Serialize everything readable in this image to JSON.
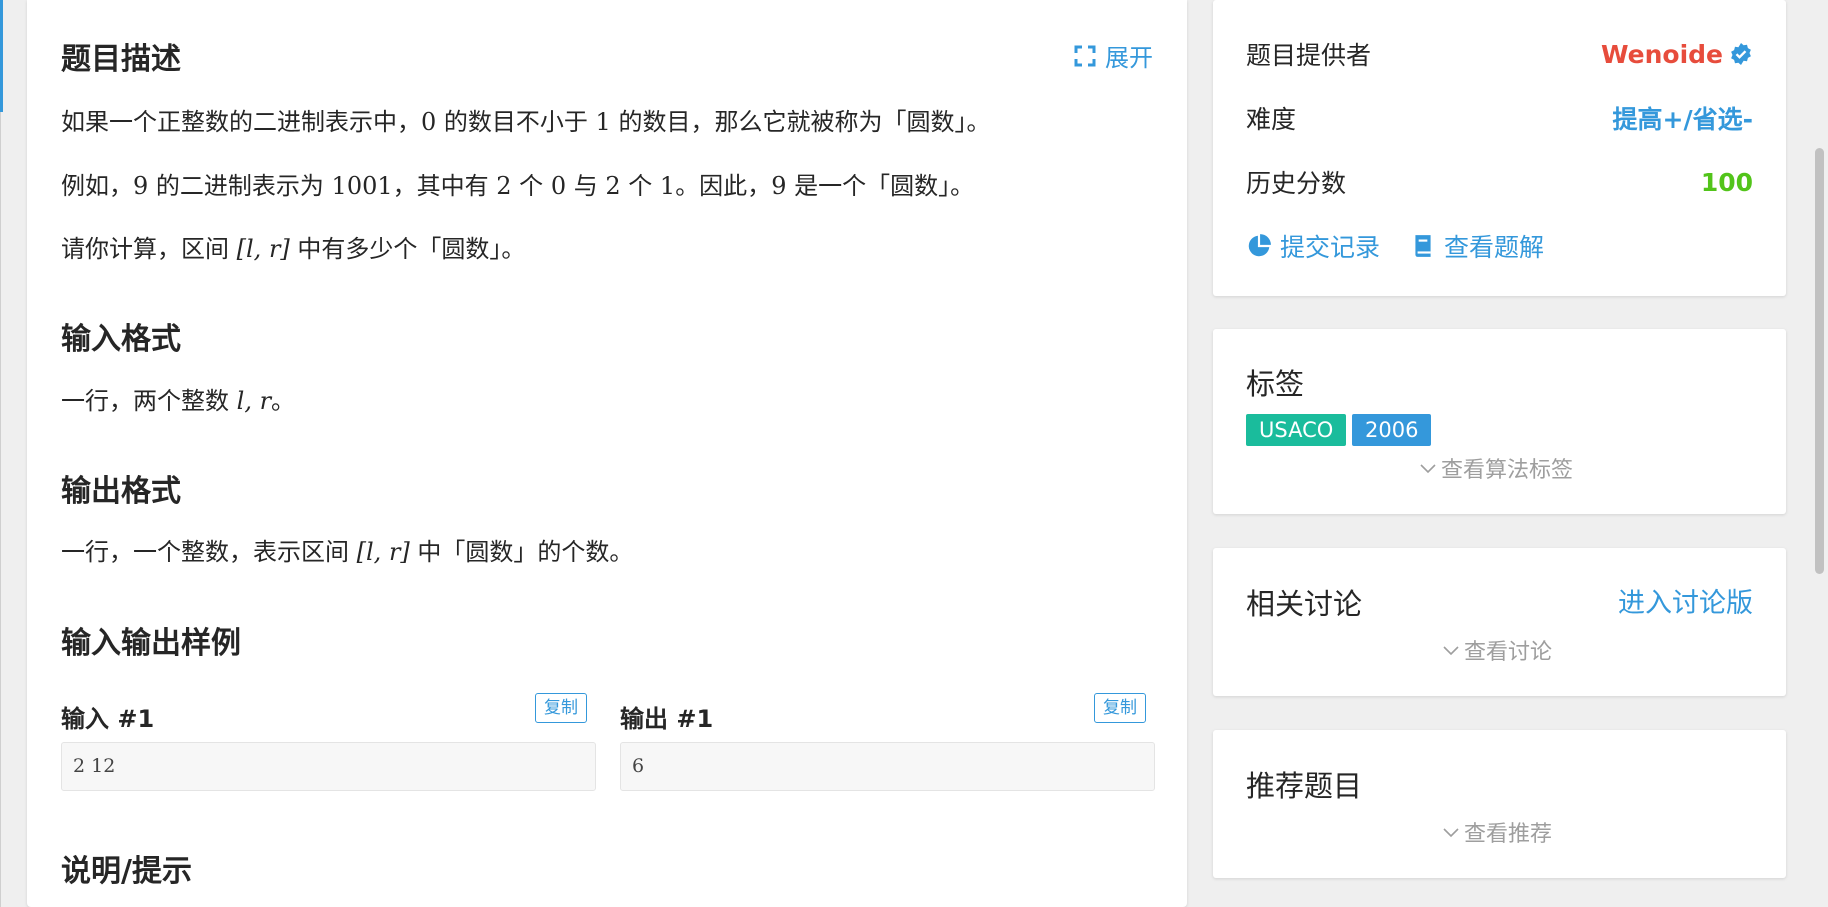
{
  "problem": {
    "description_title": "题目描述",
    "expand_label": "展开",
    "desc_p1_a": "如果一个正整数的二进制表示中，",
    "desc_p1_zero": "0",
    "desc_p1_b": " 的数目不小于 ",
    "desc_p1_one": "1",
    "desc_p1_c": " 的数目，那么它就被称为「圆数」。",
    "desc_p2_a": "例如，",
    "desc_p2_nine": "9",
    "desc_p2_b": " 的二进制表示为 ",
    "desc_p2_bin": "1001",
    "desc_p2_c": "，其中有 ",
    "desc_p2_two1": "2",
    "desc_p2_d": " 个 ",
    "desc_p2_zero": "0",
    "desc_p2_e": " 与 ",
    "desc_p2_two2": "2",
    "desc_p2_f": " 个 ",
    "desc_p2_one": "1",
    "desc_p2_g": "。因此，",
    "desc_p2_nine2": "9",
    "desc_p2_h": " 是一个「圆数」。",
    "desc_p3_a": "请你计算，区间 ",
    "desc_p3_range": "[l, r]",
    "desc_p3_b": " 中有多少个「圆数」。",
    "input_title": "输入格式",
    "input_a": "一行，两个整数 ",
    "input_vars": "l, r",
    "input_b": "。",
    "output_title": "输出格式",
    "output_a": "一行，一个整数，表示区间 ",
    "output_range": "[l, r]",
    "output_b": " 中「圆数」的个数。",
    "samples_title": "输入输出样例",
    "input_label": "输入 #1",
    "output_label": "输出 #1",
    "copy_label": "复制",
    "input_value": "2 12",
    "output_value": "6",
    "hint_title": "说明/提示"
  },
  "info": {
    "provider_key": "题目提供者",
    "provider_name": "Wenoide",
    "difficulty_key": "难度",
    "difficulty_value": "提高+/省选-",
    "score_key": "历史分数",
    "score_value": "100",
    "submissions_label": "提交记录",
    "solutions_label": "查看题解"
  },
  "tags": {
    "title": "标签",
    "items": [
      "USACO",
      "2006"
    ],
    "show_algo": "查看算法标签"
  },
  "discuss": {
    "title": "相关讨论",
    "enter_label": "进入讨论版",
    "show_label": "查看讨论"
  },
  "recommend": {
    "title": "推荐题目",
    "show_label": "查看推荐"
  },
  "colors": {
    "accent": "#3498db",
    "provider": "#e74c3c",
    "score": "#52c41a",
    "tag_usaco": "#1abc9c",
    "tag_year": "#3498db"
  },
  "icons": [
    "expand-icon",
    "verified-badge-icon",
    "pie-chart-icon",
    "book-icon",
    "chevron-down-icon"
  ]
}
